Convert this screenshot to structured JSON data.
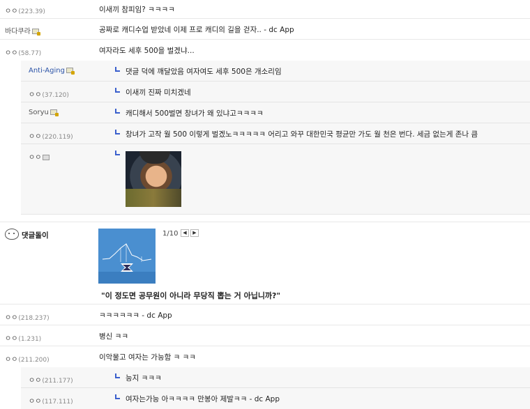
{
  "comments": [
    {
      "nick": "ㅇㅇ",
      "ip": "(223.39)",
      "text": "이새끼 참피임? ㅋㅋㅋㅋ"
    },
    {
      "nick": "바다쿠라",
      "text": "공짜로 캐디수업 받았네 이제 프로 캐디의 길을 걷자.. - dc App"
    },
    {
      "nick": "ㅇㅇ",
      "ip": "(58.77)",
      "text": "여자라도 세후 500을 벌겠냐..."
    }
  ],
  "replies": [
    {
      "nick": "Anti-Aging",
      "text": "댓글 덕에 깨달았음 여자여도 세후 500은 개소리임"
    },
    {
      "nick": "ㅇㅇ",
      "ip": "(37.120)",
      "text": "이새끼 진짜 미치겠네"
    },
    {
      "nick": "Soryu",
      "text": "캐디해서 500벌면 창녀가 왜 있냐고ㅋㅋㅋㅋ"
    },
    {
      "nick": "ㅇㅇ",
      "ip": "(220.119)",
      "text": "창녀가 고작 월 500 이렇게 벌겠노ㅋㅋㅋㅋㅋ 어리고 와꾸 대한민국 평균만 가도 월 천은 번다. 세금 없는게 존나 큼"
    },
    {
      "nick": "ㅇㅇ"
    }
  ],
  "bot": {
    "name": "댓글돌이",
    "pager": "1/10",
    "prev": "◀",
    "next": "▶",
    "title": "\"이 정도면 공무원이 아니라 무당직 뽑는 거 아닙니까?\""
  },
  "comments2": [
    {
      "nick": "ㅇㅇ",
      "ip": "(218.237)",
      "text": "ㅋㅋㅋㅋㅋㅋ - dc App"
    },
    {
      "nick": "ㅇㅇ",
      "ip": "(1.231)",
      "text": "병신 ㅋㅋ"
    },
    {
      "nick": "ㅇㅇ",
      "ip": "(211.200)",
      "text": "이악물고 여자는 가능함 ㅋ ㅋㅋ"
    }
  ],
  "replies2": [
    {
      "nick": "ㅇㅇ",
      "ip": "(211.177)",
      "text": "능지 ㅋㅋㅋ"
    },
    {
      "nick": "ㅇㅇ",
      "ip": "(117.111)",
      "text": "여자는가능 아ㅋㅋㅋㅋ 만봉아 제발ㅋㅋ - dc App"
    }
  ]
}
